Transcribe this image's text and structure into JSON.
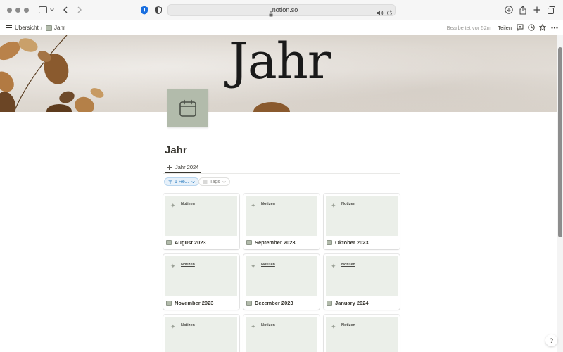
{
  "browser": {
    "url": "notion.so",
    "accent": "#1a6fe0"
  },
  "topbar": {
    "breadcrumb_root": "Übersicht",
    "breadcrumb_separator": "/",
    "breadcrumb_current": "Jahr",
    "edited": "Bearbeitet vor 52m",
    "share": "Teilen"
  },
  "cover": {
    "title": "Jahr"
  },
  "page": {
    "title": "Jahr",
    "tab_label": "Jahr 2024"
  },
  "filters": {
    "filter_label": "1 Re...",
    "tags_label": "Tags"
  },
  "gallery": {
    "cards": [
      {
        "title": "August 2023",
        "preview_text": "Notizen"
      },
      {
        "title": "September 2023",
        "preview_text": "Notizen"
      },
      {
        "title": "Oktober 2023",
        "preview_text": "Notizen"
      },
      {
        "title": "November 2023",
        "preview_text": "Notizen"
      },
      {
        "title": "Dezember 2023",
        "preview_text": "Notizen"
      },
      {
        "title": "January 2024",
        "preview_text": "Notizen"
      },
      {
        "title": "",
        "preview_text": "Notizen"
      },
      {
        "title": "",
        "preview_text": "Notizen"
      },
      {
        "title": "",
        "preview_text": "Notizen"
      }
    ]
  },
  "help": {
    "label": "?"
  },
  "colors": {
    "page_icon_bg": "#b2bbab",
    "card_preview_bg": "#ebefe9",
    "filter_pill": "#2f7fc1"
  }
}
